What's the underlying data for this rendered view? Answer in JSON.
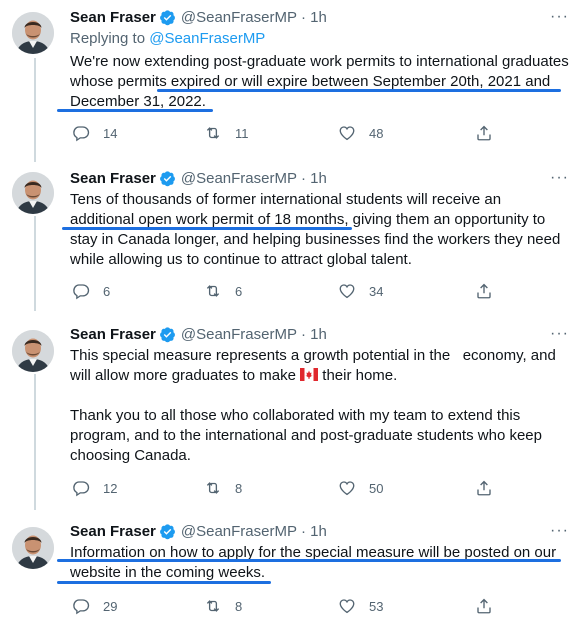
{
  "author": {
    "name": "Sean Fraser",
    "handle": "@SeanFraserMP",
    "time": "· 1h"
  },
  "colors": {
    "accent": "#1d9bf0",
    "underline": "#1d6fe0",
    "muted": "#536471"
  },
  "icons": {
    "verified": "verified-badge-icon",
    "reply": "reply-icon",
    "retweet": "retweet-icon",
    "like": "heart-icon",
    "share": "share-icon",
    "more": "more-icon"
  },
  "more_label": "···",
  "tweets": [
    {
      "replying_prefix": "Replying to",
      "replying_to": "@SeanFraserMP",
      "text_lines": [
        "We're now extending post-graduate work permits to international graduates",
        "whose permits expired or will expire between September 20th, 2021 and",
        "December 31, 2022."
      ],
      "replies": "14",
      "retweets": "11",
      "likes": "48"
    },
    {
      "text_lines": [
        "Tens of thousands of former international students will receive an",
        "additional open work permit of 18 months, giving them an opportunity to",
        "stay in Canada longer, and helping businesses find the workers they need",
        "while allowing us to continue to attract global talent."
      ],
      "replies": "6",
      "retweets": "6",
      "likes": "34"
    },
    {
      "text_lines": [
        "This special measure represents a growth potential in the   economy, and",
        "will allow more graduates to make",
        "",
        "Thank you to all those who collaborated with my team to extend this",
        "program, and to the international and post-graduate students who keep",
        "choosing Canada."
      ],
      "line2_suffix": " their home.",
      "replies": "12",
      "retweets": "8",
      "likes": "50"
    },
    {
      "text_lines": [
        "Information on how to apply for the special measure will be posted on our",
        "website in the coming weeks."
      ],
      "replies": "29",
      "retweets": "8",
      "likes": "53"
    }
  ]
}
